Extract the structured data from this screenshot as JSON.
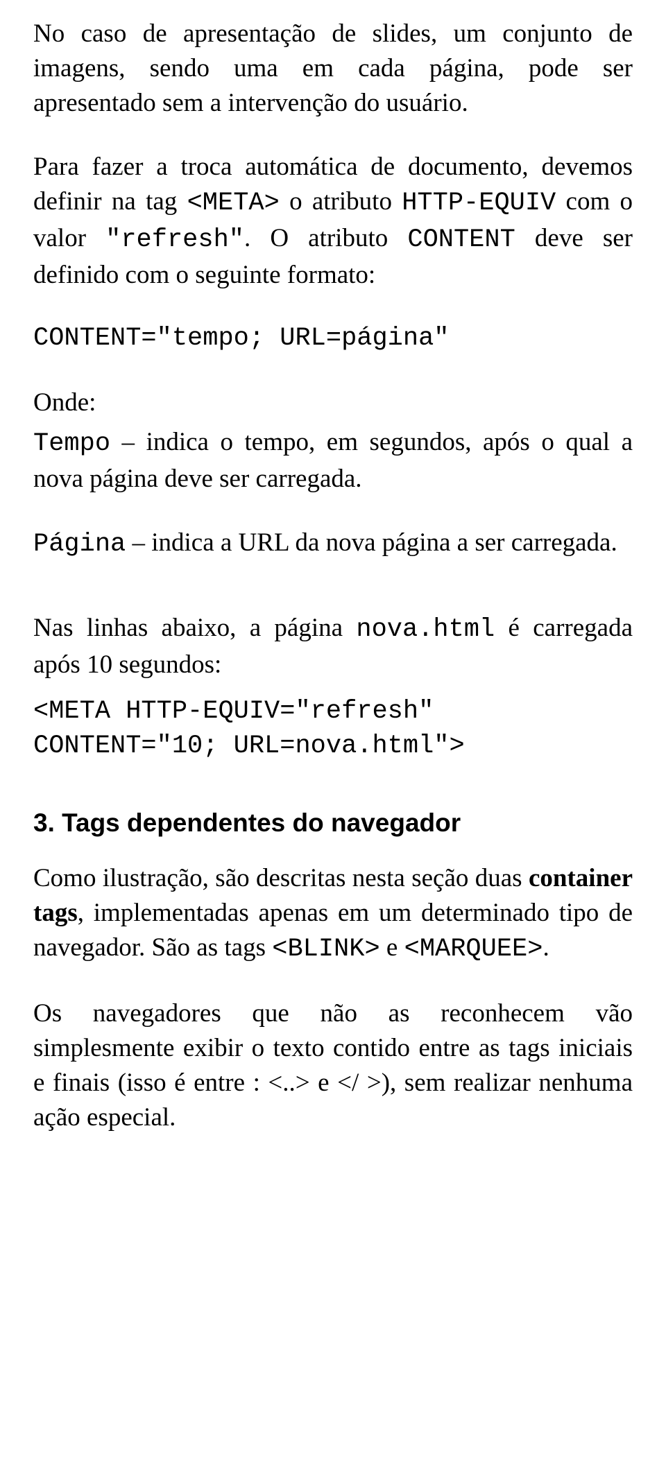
{
  "p1_a": "No caso de apresentação de slides, um conjunto de imagens, sendo uma em cada página, pode ser apresentado sem a intervenção do usuário.",
  "p2_a": "Para fazer a troca automática de documento, devemos definir na tag ",
  "p2_meta": "<META>",
  "p2_b": " o atributo ",
  "p2_httpequiv": "HTTP-EQUIV",
  "p2_c": " com o valor ",
  "p2_refresh": "\"refresh\"",
  "p2_d": ". O atributo ",
  "p2_content": "CONTENT",
  "p2_e": " deve ser definido com o seguinte formato:",
  "code1": "CONTENT=\"tempo; URL=página\"",
  "onde_label": "Onde:",
  "p3_tempo": "Tempo",
  "p3_a": " – indica o tempo, em segundos, após o qual a nova página deve ser carregada.",
  "p4_pagina": "Página",
  "p4_a": " – indica a URL da nova página a ser carregada.",
  "p5_a": "Nas linhas abaixo, a página ",
  "p5_nova": "nova.html",
  "p5_b": " é carregada após 10 segundos:",
  "code2": "<META HTTP-EQUIV=\"refresh\"\nCONTENT=\"10; URL=nova.html\">",
  "h3": "3. Tags dependentes do navegador",
  "p6_a": "Como ilustração, são descritas nesta seção duas ",
  "p6_b1": "container tags",
  "p6_b": ", implementadas apenas em um determinado tipo de navegador. São as tags ",
  "p6_blink": "<BLINK>",
  "p6_c": " e ",
  "p6_marquee": "<MARQUEE>",
  "p6_d": ".",
  "p7_a": "Os navegadores que não as reconhecem vão simplesmente exibir o texto contido entre as tags iniciais e finais (isso é entre : <..> e </ >), sem realizar nenhuma ação especial."
}
